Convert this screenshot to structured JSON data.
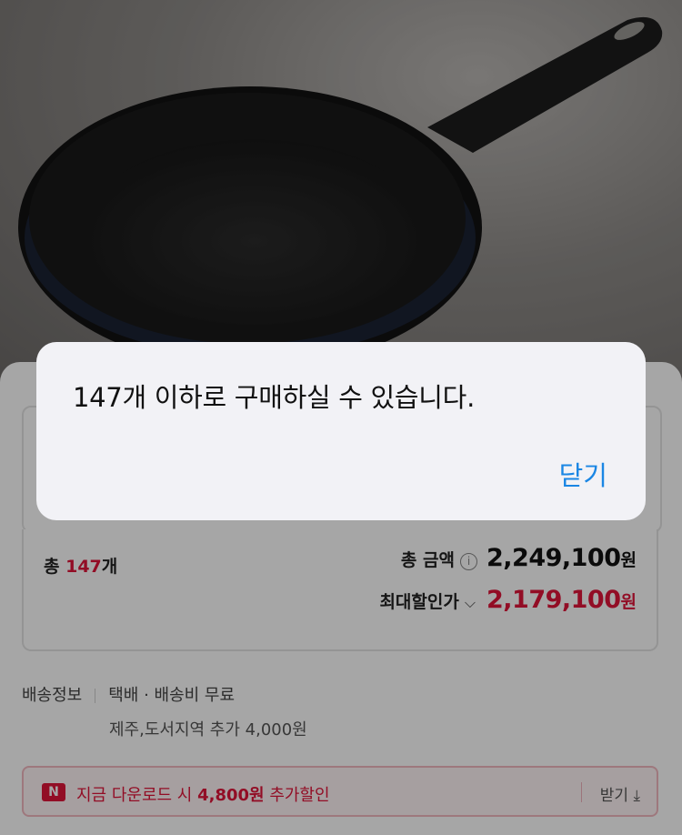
{
  "summary": {
    "qty_prefix": "총 ",
    "qty_value": "147",
    "qty_suffix": "개",
    "total_label": "총 금액",
    "info_symbol": "i",
    "total_price": "2,249,100",
    "won": "원",
    "discount_label": "최대할인가",
    "chevron": "⌵",
    "discount_price": "2,179,100"
  },
  "shipping": {
    "label": "배송정보",
    "value": "택배 · 배송비 무료",
    "extra": "제주,도서지역 추가 4,000원"
  },
  "coupon": {
    "badge": "N",
    "text_prefix": "지금 다운로드 시 ",
    "amount": "4,800원",
    "text_suffix": " 추가할인",
    "download_label": "받기",
    "download_icon": "⤓"
  },
  "dialog": {
    "message": "147개 이하로 구매하실 수 있습니다.",
    "close_label": "닫기"
  },
  "colors": {
    "accent_red": "#e1153a",
    "ios_blue": "#1a86e4"
  }
}
